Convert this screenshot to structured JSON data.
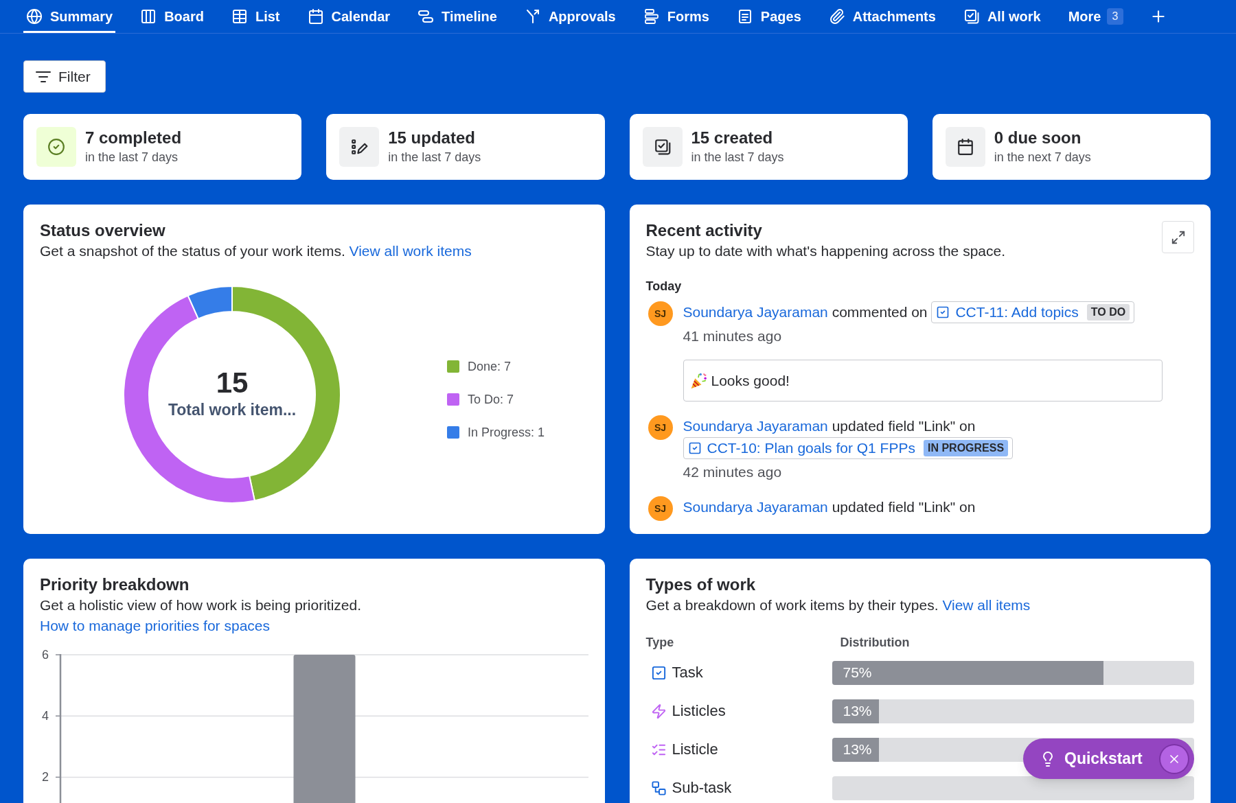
{
  "nav": {
    "tabs": [
      {
        "kind": "summary",
        "label": "Summary",
        "selected": true
      },
      {
        "kind": "board",
        "label": "Board",
        "selected": false
      },
      {
        "kind": "list",
        "label": "List",
        "selected": false
      },
      {
        "kind": "calendar",
        "label": "Calendar",
        "selected": false
      },
      {
        "kind": "timeline",
        "label": "Timeline",
        "selected": false
      },
      {
        "kind": "approvals",
        "label": "Approvals",
        "selected": false
      },
      {
        "kind": "forms",
        "label": "Forms",
        "selected": false
      },
      {
        "kind": "pages",
        "label": "Pages",
        "selected": false
      },
      {
        "kind": "attachments",
        "label": "Attachments",
        "selected": false
      },
      {
        "kind": "all_work",
        "label": "All work",
        "selected": false
      }
    ],
    "more": {
      "label": "More",
      "count": "3"
    }
  },
  "filter_button": {
    "label": "Filter"
  },
  "stat_cards": [
    {
      "kind": "completed",
      "title": "7 completed",
      "subtitle": "in the last 7 days"
    },
    {
      "kind": "updated",
      "title": "15 updated",
      "subtitle": "in the last 7 days"
    },
    {
      "kind": "created",
      "title": "15 created",
      "subtitle": "in the last 7 days"
    },
    {
      "kind": "due",
      "title": "0 due soon",
      "subtitle": "in the next 7 days"
    }
  ],
  "status_overview": {
    "title": "Status overview",
    "description": "Get a snapshot of the status of your work items.",
    "link": "View all work items",
    "chart_data": {
      "type": "donut",
      "categories": [
        "Done: 7",
        "To Do: 7",
        "In Progress: 1"
      ],
      "values": [
        7,
        7,
        1
      ],
      "colors": [
        "#82b536",
        "#bf63f3",
        "#357de8"
      ]
    },
    "center": {
      "value": "15",
      "label": "Total work item..."
    }
  },
  "recent_activity": {
    "title": "Recent activity",
    "description": "Stay up to date with what's happening across the space.",
    "group_label": "Today",
    "items": [
      {
        "avatar": "SJ",
        "actor": "Soundarya Jayaraman",
        "action": "commented on",
        "work_item": {
          "title": "CCT-11: Add topics",
          "status": "TO DO",
          "color": "#dddee1"
        },
        "time": "41 minutes ago",
        "comment": "Looks good!"
      },
      {
        "avatar": "SJ",
        "actor": "Soundarya Jayaraman",
        "action": "updated field \"Link\" on",
        "work_item": {
          "title": "CCT-10: Plan goals for Q1 FPPs",
          "status": "IN PROGRESS",
          "color": "#8fb8f6"
        },
        "time": "42 minutes ago"
      },
      {
        "avatar": "SJ",
        "actor": "Soundarya Jayaraman",
        "action": "updated field \"Link\" on"
      }
    ]
  },
  "priority_breakdown": {
    "title": "Priority breakdown",
    "description": "Get a holistic view of how work is being prioritized.",
    "link": "How to manage priorities for spaces",
    "chart_data": {
      "type": "bar",
      "values": [
        6
      ],
      "ylim": [
        0,
        6
      ],
      "yticks": [
        2,
        4,
        6
      ]
    }
  },
  "types_of_work": {
    "title": "Types of work",
    "description": "Get a breakdown of work items by their types.",
    "link": "View all items",
    "columns": [
      "Type",
      "Distribution"
    ],
    "rows": [
      {
        "kind": "task",
        "label": "Task",
        "level": 0.75,
        "reading": "75%"
      },
      {
        "kind": "listicles",
        "label": "Listicles",
        "level": 0.13,
        "reading": "13%"
      },
      {
        "kind": "listicle",
        "label": "Listicle",
        "level": 0.13,
        "reading": "13%"
      },
      {
        "kind": "subtask",
        "label": "Sub-task"
      }
    ]
  },
  "quickstart": {
    "label": "Quickstart"
  }
}
